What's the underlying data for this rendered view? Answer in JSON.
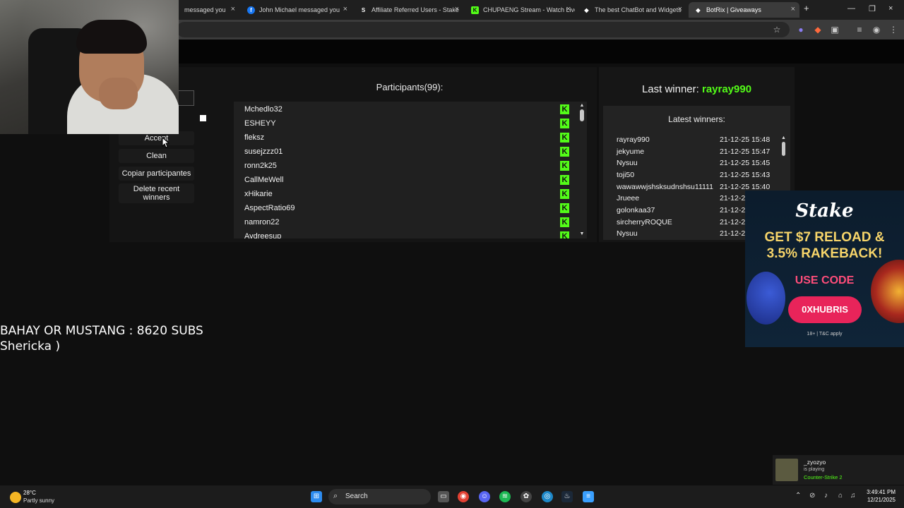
{
  "browser": {
    "tabs": [
      {
        "title": "messaged you",
        "icon": "fb-icon",
        "active": false
      },
      {
        "title": "John Michael messaged you",
        "icon": "fb-icon",
        "active": false
      },
      {
        "title": "Affiliate Referred Users - Stake",
        "icon": "stake-icon",
        "active": false
      },
      {
        "title": "CHUPAENG Stream - Watch Live",
        "icon": "kick-icon",
        "active": false
      },
      {
        "title": "The best ChatBot and Widgets",
        "icon": "botrix-icon",
        "active": false
      },
      {
        "title": "BotRix | Giveaways",
        "icon": "botrix-icon",
        "active": true
      }
    ],
    "new_tab": "+",
    "close_glyph": "×"
  },
  "giveaway": {
    "controls": {
      "accept": "Accept",
      "clean": "Clean",
      "copy": "Copiar participantes",
      "delete_recent": "Delete recent winners"
    },
    "participants_title": "Participants(99):",
    "participants": [
      "Mchedlo32",
      "ESHEYY",
      "fleksz",
      "susejzzz01",
      "ronn2k25",
      "CallMeWell",
      "xHikarie",
      "AspectRatio69",
      "namron22",
      "Aydreesup"
    ],
    "platform_badge": "K",
    "last_winner_label": "Last winner:",
    "last_winner": "rayray990",
    "latest_winners_title": "Latest winners:",
    "latest_winners": [
      {
        "name": "rayray990",
        "date": "21-12-25 15:48"
      },
      {
        "name": "jekyume",
        "date": "21-12-25 15:47"
      },
      {
        "name": "Nysuu",
        "date": "21-12-25 15:45"
      },
      {
        "name": "toji50",
        "date": "21-12-25 15:43"
      },
      {
        "name": "wawawwjshsksudnshsu11111",
        "date": "21-12-25 15:40"
      },
      {
        "name": "Jrueee",
        "date": "21-12-2"
      },
      {
        "name": "golonkaa37",
        "date": "21-12-2"
      },
      {
        "name": "sircherryROQUE",
        "date": "21-12-2"
      },
      {
        "name": "Nysuu",
        "date": "21-12-2"
      }
    ]
  },
  "overlay": {
    "line1": "BAHAY OR MUSTANG : 8620 SUBS",
    "line2": "Shericka )"
  },
  "ad": {
    "brand": "Stake",
    "headline1": "GET $7 RELOAD &",
    "headline2": "3.5% RAKEBACK!",
    "use_code": "USE CODE",
    "code": "0XHUBRIS",
    "fine_print": "18+ | T&C apply"
  },
  "notification": {
    "user": "_zyozyo",
    "status": "is playing",
    "game": "Counter-Strike 2"
  },
  "taskbar": {
    "weather_temp": "28°C",
    "weather_desc": "Partly sunny",
    "search_label": "Search",
    "time": "3:49:41 PM",
    "date": "12/21/2025"
  },
  "colors": {
    "accent_green": "#53fc18",
    "stake_pink": "#e8245a",
    "stake_gold": "#f7d56a"
  }
}
